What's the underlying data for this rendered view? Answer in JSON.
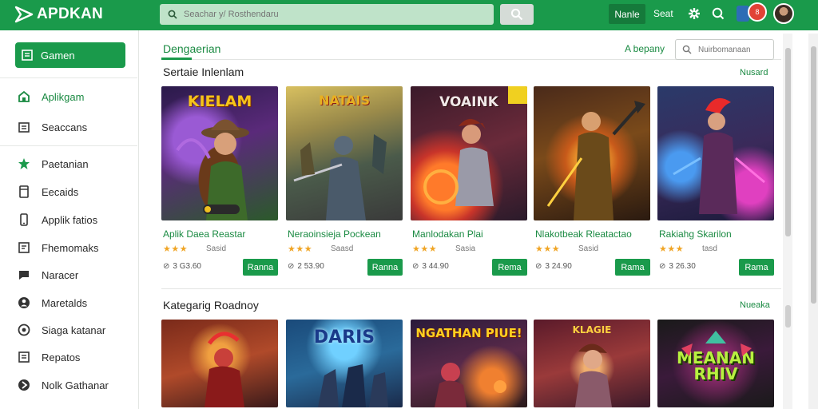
{
  "header": {
    "logo": "APDKAN",
    "search_placeholder": "Seachar y/ Rosthendaru",
    "pill_label": "Nanle",
    "link_label": "Seat",
    "notification_count": "8"
  },
  "sidebar": {
    "primary_button": "Gamen",
    "items": [
      {
        "label": "Aplikgam",
        "icon": "store-icon"
      },
      {
        "label": "Seaccans",
        "icon": "download-icon"
      },
      {
        "label": "Paetanian",
        "icon": "star-icon"
      },
      {
        "label": "Eecaids",
        "icon": "book-icon"
      },
      {
        "label": "Applik fatios",
        "icon": "phone-icon"
      },
      {
        "label": "Fhemomaks",
        "icon": "document-icon"
      },
      {
        "label": "Naracer",
        "icon": "chat-icon"
      },
      {
        "label": "Maretalds",
        "icon": "person-icon"
      },
      {
        "label": "Siaga katanar",
        "icon": "settings-icon"
      },
      {
        "label": "Repatos",
        "icon": "list-icon"
      },
      {
        "label": "Nolk Gathanar",
        "icon": "circle-icon"
      }
    ]
  },
  "main": {
    "tab": "Dengaerian",
    "sort_label": "A bepany",
    "filter_placeholder": "Nuirbomanaan",
    "sections": [
      {
        "title": "Sertaie Inlenlam",
        "link": "Nusard",
        "cards": [
          {
            "thumb_text": "KIELAM",
            "title": "Aplik Daea Reastar",
            "rating_label": "Sasid",
            "downloads": "3 G3.60",
            "button": "Ranna"
          },
          {
            "thumb_text": "NATAIS",
            "title": "Neraoinsieja Pockean",
            "rating_label": "Saasd",
            "downloads": "2 53.90",
            "button": "Ranna"
          },
          {
            "thumb_text": "VOAINK",
            "title": "Manlodakan Plai",
            "rating_label": "Sasia",
            "downloads": "3 44.90",
            "button": "Rema"
          },
          {
            "thumb_text": "",
            "title": "Nlakotbeak Rleatactao",
            "rating_label": "Sasid",
            "downloads": "3 24.90",
            "button": "Rama"
          },
          {
            "thumb_text": "",
            "title": "Rakiahg Skarilon",
            "rating_label": "tasd",
            "downloads": "3 26.30",
            "button": "Rama"
          }
        ]
      },
      {
        "title": "Kategarig Roadnoy",
        "link": "Nueaka",
        "cards": [
          {
            "thumb_text": ""
          },
          {
            "thumb_text": "DARIS"
          },
          {
            "thumb_text": "NGATHAN PIUE!"
          },
          {
            "thumb_text": "KLAGIE"
          },
          {
            "thumb_text": "MEANAN RHIV"
          }
        ]
      }
    ]
  },
  "colors": {
    "brand": "#1a9a4b",
    "accent_text": "#1a8a42",
    "star": "#f0a526"
  }
}
